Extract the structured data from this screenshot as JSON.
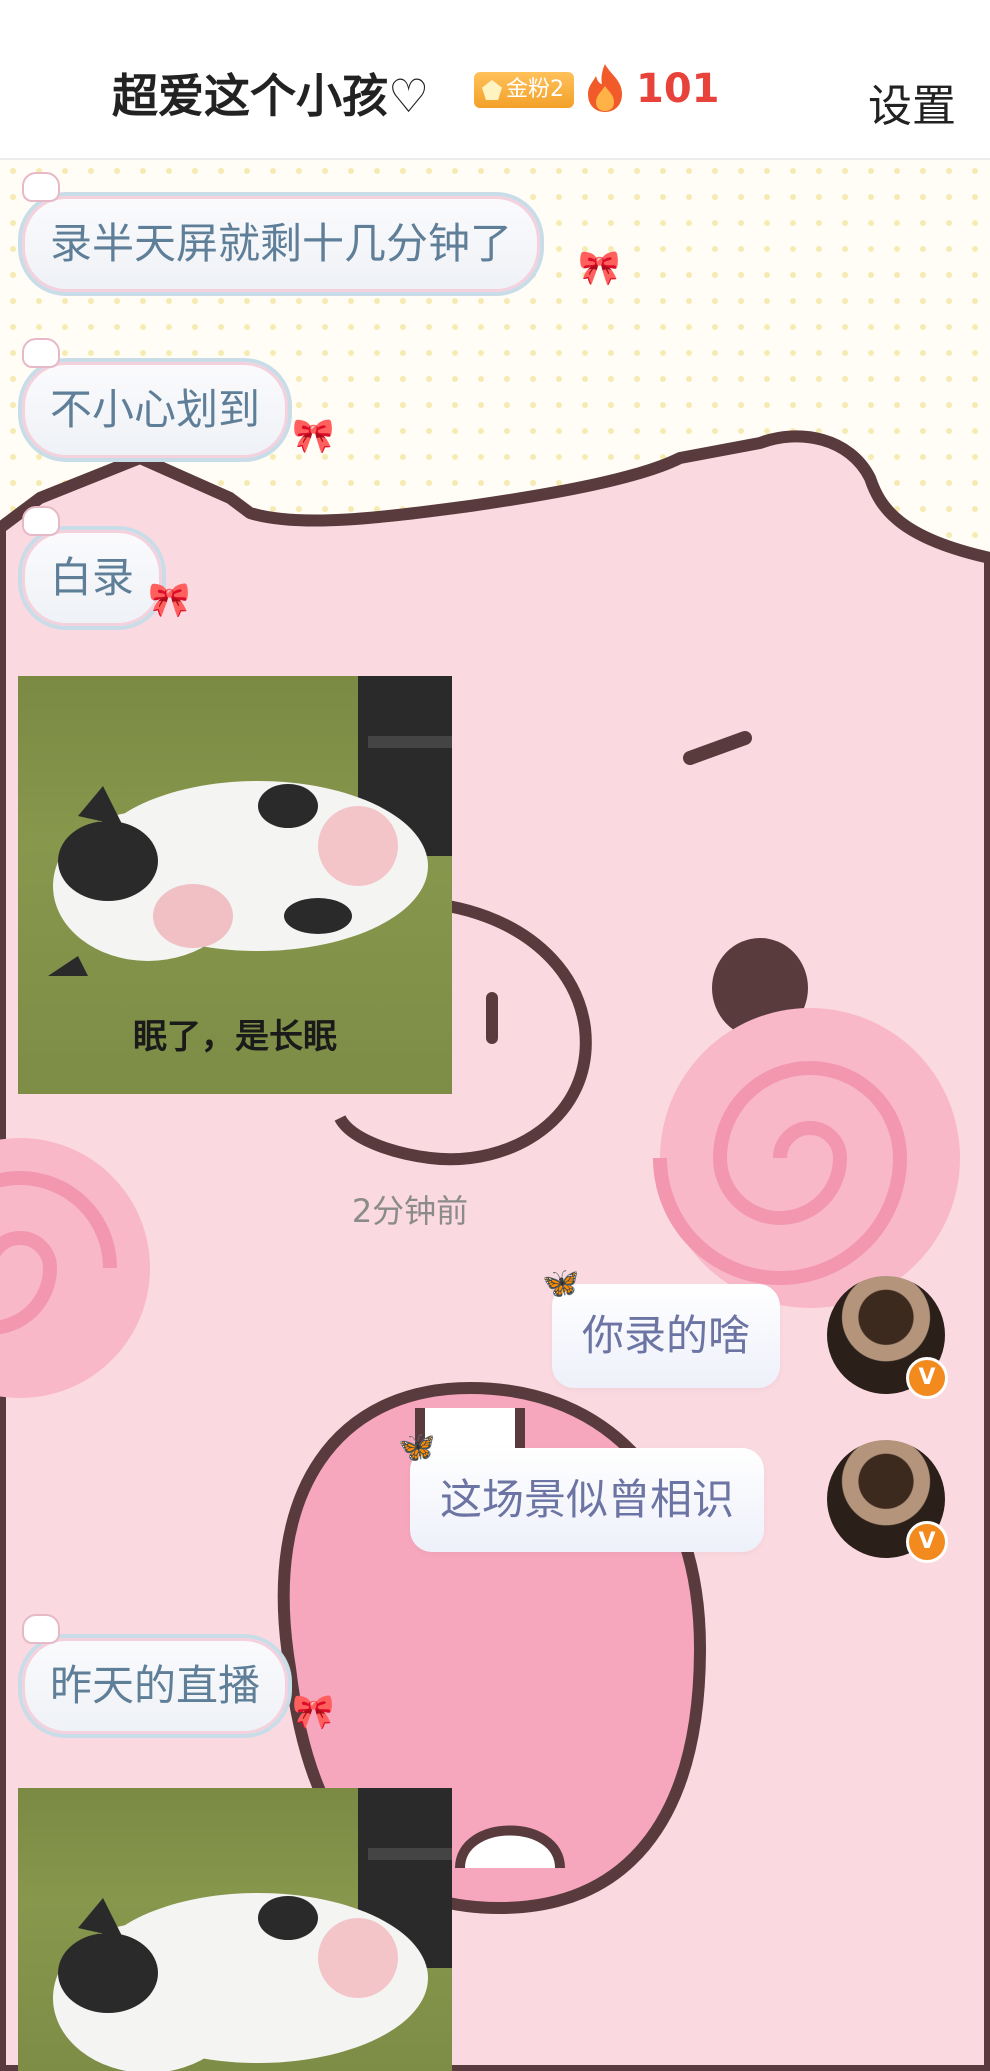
{
  "header": {
    "title": "超爱这个小孩♡",
    "fan_badge": "金粉2",
    "fire_count": "101",
    "settings_label": "设置"
  },
  "messages": {
    "m1": "录半天屏就剩十几分钟了",
    "m2": "不小心划到",
    "m3": "白录",
    "sticker_caption": "眠了，是长眠",
    "timestamp": "2分钟前",
    "r1": "你录的啥",
    "r2": "这场景似曾相识",
    "m4": "昨天的直播"
  },
  "colors": {
    "background_pink": "#fbd9e0",
    "fire_count": "#e8433a",
    "badge_gold": "#f3a12a",
    "left_bubble_text": "#5f7f99",
    "right_bubble_text": "#6c74a3"
  }
}
